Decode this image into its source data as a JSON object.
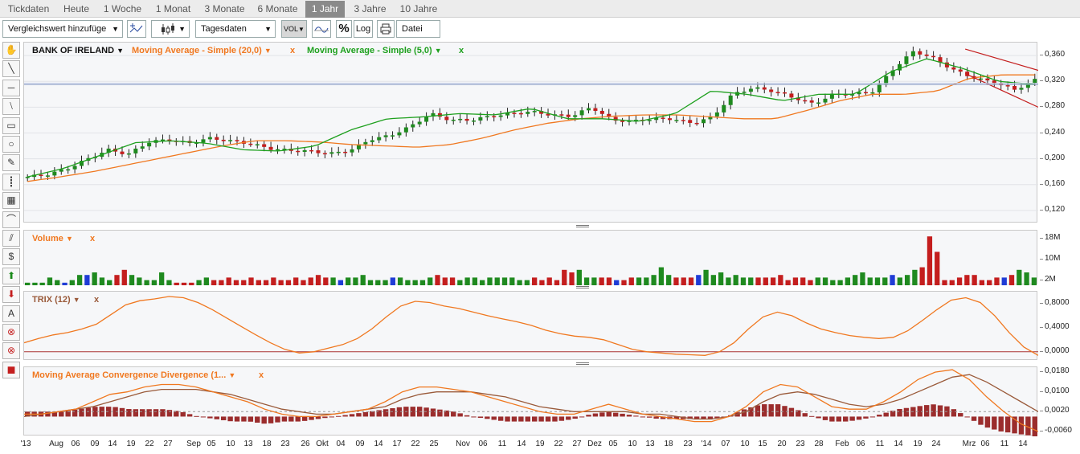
{
  "tabs": [
    {
      "label": "Tickdaten",
      "active": false
    },
    {
      "label": "Heute",
      "active": false
    },
    {
      "label": "1 Woche",
      "active": false
    },
    {
      "label": "1 Monat",
      "active": false
    },
    {
      "label": "3 Monate",
      "active": false
    },
    {
      "label": "6 Monate",
      "active": false
    },
    {
      "label": "1 Jahr",
      "active": true
    },
    {
      "label": "3 Jahre",
      "active": false
    },
    {
      "label": "10 Jahre",
      "active": false
    }
  ],
  "toolbar": {
    "compare_label": "Vergleichswert hinzufüge",
    "interval_label": "Tagesdaten",
    "vol_label": "VOL",
    "percent_label": "%",
    "log_label": "Log",
    "file_label": "Datei"
  },
  "main_panel": {
    "instrument": "BANK OF IRELAND",
    "ma20_label": "Moving Average - Simple (20,0)",
    "ma5_label": "Moving Average - Simple (5,0)",
    "close_glyph": "x",
    "y_ticks": [
      "0,360",
      "0,320",
      "0,280",
      "0,240",
      "0,200",
      "0,160",
      "0,120"
    ]
  },
  "volume_panel": {
    "label": "Volume",
    "close_glyph": "x",
    "y_ticks": [
      "18M",
      "10M",
      "2M"
    ]
  },
  "trix_panel": {
    "label": "TRIX (12)",
    "close_glyph": "x",
    "y_ticks": [
      "0,8000",
      "0,4000",
      "0,0000"
    ]
  },
  "macd_panel": {
    "label": "Moving Average Convergence Divergence (1...",
    "close_glyph": "x",
    "y_ticks": [
      "0,0180",
      "0,0100",
      "0,0020",
      "-0,0060"
    ]
  },
  "x_axis": {
    "labels": [
      "'13",
      "Aug",
      "06",
      "09",
      "14",
      "19",
      "22",
      "27",
      "Sep",
      "05",
      "10",
      "13",
      "18",
      "23",
      "26",
      "Okt",
      "04",
      "09",
      "14",
      "17",
      "22",
      "25",
      "Nov",
      "06",
      "11",
      "14",
      "19",
      "22",
      "27",
      "Dez",
      "05",
      "10",
      "13",
      "18",
      "23",
      "'14",
      "07",
      "10",
      "15",
      "20",
      "23",
      "28",
      "Feb",
      "06",
      "11",
      "14",
      "19",
      "24",
      "Mrz",
      "06",
      "11",
      "14"
    ]
  },
  "colors": {
    "up": "#1f8a1f",
    "down": "#c41e1e",
    "neutral": "#1f3cd6",
    "ma20": "#f07820",
    "ma5": "#1ea01e",
    "trix": "#f07820",
    "macd_line": "#f07820",
    "signal_line": "#9a5a3a",
    "histogram": "#9b2d2d",
    "channel": "#c41e1e"
  },
  "chart_data": [
    {
      "type": "candlestick",
      "title": "BANK OF IRELAND",
      "ylim": [
        0.1,
        0.38
      ],
      "x_start": "'13",
      "x_end": "14 Mrz",
      "close_anchors": [
        0.172,
        0.176,
        0.185,
        0.2,
        0.214,
        0.207,
        0.226,
        0.23,
        0.224,
        0.232,
        0.228,
        0.224,
        0.216,
        0.213,
        0.212,
        0.208,
        0.213,
        0.23,
        0.236,
        0.25,
        0.27,
        0.26,
        0.26,
        0.266,
        0.27,
        0.273,
        0.268,
        0.266,
        0.28,
        0.26,
        0.258,
        0.262,
        0.262,
        0.255,
        0.265,
        0.3,
        0.31,
        0.305,
        0.295,
        0.285,
        0.3,
        0.3,
        0.305,
        0.34,
        0.367,
        0.355,
        0.337,
        0.325,
        0.318,
        0.307,
        0.322
      ],
      "series": [
        {
          "name": "Moving Average - Simple (20,0)",
          "values": [
            0.165,
            0.172,
            0.18,
            0.19,
            0.2,
            0.21,
            0.22,
            0.228,
            0.228,
            0.226,
            0.222,
            0.22,
            0.218,
            0.222,
            0.232,
            0.245,
            0.255,
            0.262,
            0.266,
            0.268,
            0.268,
            0.265,
            0.262,
            0.262,
            0.275,
            0.29,
            0.3,
            0.3,
            0.305,
            0.325,
            0.33,
            0.33
          ]
        },
        {
          "name": "Moving Average - Simple (5,0)",
          "values": [
            0.172,
            0.185,
            0.205,
            0.225,
            0.228,
            0.224,
            0.214,
            0.212,
            0.22,
            0.245,
            0.262,
            0.265,
            0.27,
            0.268,
            0.278,
            0.262,
            0.262,
            0.258,
            0.27,
            0.305,
            0.3,
            0.29,
            0.3,
            0.3,
            0.335,
            0.355,
            0.34,
            0.32,
            0.315
          ]
        }
      ]
    },
    {
      "type": "bar",
      "title": "Volume",
      "ylim": [
        0,
        20
      ],
      "unit": "M",
      "values": [
        1,
        1,
        1,
        3,
        2,
        1,
        2,
        4,
        4,
        5,
        3,
        2,
        4,
        6,
        4,
        3,
        2,
        2,
        5,
        2,
        1,
        1,
        1,
        2,
        3,
        2,
        2,
        3,
        2,
        2,
        3,
        2,
        2,
        3,
        2,
        2,
        3,
        2,
        3,
        4,
        3,
        3,
        2,
        3,
        3,
        4,
        2,
        2,
        2,
        3,
        3,
        2,
        2,
        2,
        3,
        4,
        3,
        3,
        2,
        3,
        3,
        2,
        3,
        3,
        3,
        3,
        2,
        2,
        3,
        2,
        3,
        2,
        6,
        5,
        6,
        3,
        3,
        3,
        3,
        2,
        2,
        3,
        3,
        3,
        4,
        7,
        4,
        3,
        3,
        3,
        4,
        6,
        4,
        5,
        3,
        4,
        3,
        3,
        3,
        3,
        3,
        4,
        2,
        3,
        3,
        2,
        3,
        3,
        2,
        2,
        3,
        4,
        5,
        3,
        3,
        3,
        4,
        3,
        4,
        6,
        7,
        19,
        13,
        2,
        2,
        3,
        4,
        4,
        2,
        2,
        3,
        3,
        4,
        6,
        5,
        3
      ]
    },
    {
      "type": "line",
      "title": "TRIX (12)",
      "ylim": [
        -0.15,
        1.0
      ],
      "values": [
        0.15,
        0.22,
        0.28,
        0.32,
        0.38,
        0.46,
        0.62,
        0.78,
        0.85,
        0.88,
        0.92,
        0.9,
        0.82,
        0.7,
        0.56,
        0.42,
        0.28,
        0.15,
        0.04,
        -0.02,
        0.0,
        0.06,
        0.12,
        0.22,
        0.38,
        0.58,
        0.76,
        0.84,
        0.82,
        0.76,
        0.72,
        0.66,
        0.6,
        0.55,
        0.5,
        0.44,
        0.36,
        0.3,
        0.26,
        0.24,
        0.2,
        0.12,
        0.04,
        0.0,
        -0.02,
        -0.04,
        -0.05,
        -0.06,
        0.0,
        0.15,
        0.38,
        0.58,
        0.66,
        0.6,
        0.48,
        0.38,
        0.32,
        0.27,
        0.24,
        0.22,
        0.24,
        0.35,
        0.52,
        0.7,
        0.86,
        0.9,
        0.82,
        0.6,
        0.32,
        0.08,
        -0.06
      ]
    },
    {
      "type": "line",
      "title": "Moving Average Convergence Divergence (1...",
      "ylim": [
        -0.008,
        0.02
      ],
      "series": [
        {
          "name": "MACD",
          "values": [
            0.001,
            0.001,
            0.002,
            0.003,
            0.006,
            0.009,
            0.01,
            0.012,
            0.013,
            0.013,
            0.012,
            0.01,
            0.008,
            0.006,
            0.003,
            0.001,
            0.0,
            0.0,
            0.001,
            0.002,
            0.003,
            0.006,
            0.01,
            0.012,
            0.012,
            0.011,
            0.01,
            0.008,
            0.006,
            0.004,
            0.002,
            0.001,
            0.001,
            0.003,
            0.005,
            0.003,
            0.001,
            0.0,
            -0.001,
            -0.002,
            -0.002,
            0.0,
            0.004,
            0.01,
            0.013,
            0.012,
            0.008,
            0.004,
            0.003,
            0.003,
            0.006,
            0.01,
            0.015,
            0.018,
            0.019,
            0.015,
            0.008,
            0.002,
            -0.003,
            -0.006
          ]
        },
        {
          "name": "Signal",
          "values": [
            0.0,
            0.001,
            0.002,
            0.003,
            0.004,
            0.006,
            0.008,
            0.01,
            0.011,
            0.011,
            0.011,
            0.01,
            0.009,
            0.007,
            0.005,
            0.003,
            0.002,
            0.001,
            0.001,
            0.002,
            0.003,
            0.004,
            0.007,
            0.009,
            0.01,
            0.01,
            0.01,
            0.009,
            0.008,
            0.006,
            0.004,
            0.003,
            0.002,
            0.002,
            0.002,
            0.002,
            0.001,
            0.001,
            0.0,
            -0.001,
            -0.001,
            0.0,
            0.002,
            0.006,
            0.009,
            0.01,
            0.009,
            0.007,
            0.005,
            0.004,
            0.005,
            0.007,
            0.01,
            0.013,
            0.016,
            0.017,
            0.014,
            0.01,
            0.006,
            0.002
          ]
        },
        {
          "name": "Histogram",
          "values": [
            0.002,
            0.002,
            0.002,
            0.003,
            0.004,
            0.004,
            0.003,
            0.003,
            0.003,
            0.002,
            0.0,
            -0.001,
            -0.002,
            -0.002,
            -0.003,
            -0.002,
            -0.002,
            -0.001,
            0.0,
            0.001,
            0.002,
            0.003,
            0.004,
            0.004,
            0.003,
            0.002,
            0.0,
            -0.001,
            -0.002,
            -0.002,
            -0.002,
            -0.002,
            -0.001,
            0.001,
            0.002,
            0.001,
            0.0,
            -0.001,
            -0.001,
            -0.001,
            -0.001,
            0.0,
            0.003,
            0.005,
            0.005,
            0.003,
            0.0,
            -0.002,
            -0.002,
            -0.001,
            0.001,
            0.003,
            0.004,
            0.005,
            0.004,
            0.0,
            -0.004,
            -0.006,
            -0.007,
            -0.008
          ]
        }
      ]
    }
  ]
}
